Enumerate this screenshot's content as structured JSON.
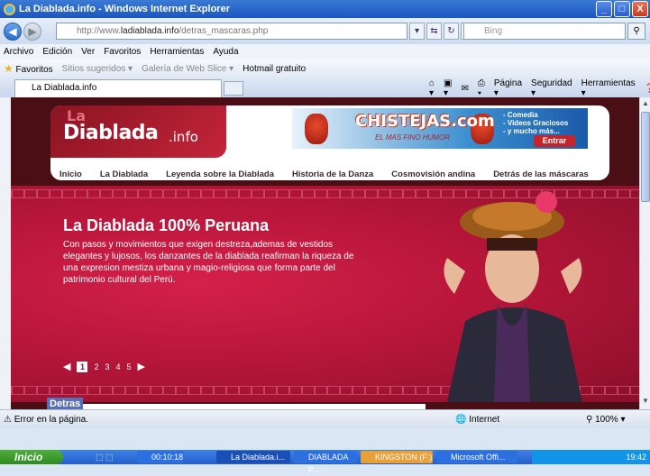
{
  "window": {
    "title": "La Diablada.info - Windows Internet Explorer",
    "minimize": "_",
    "maximize": "□",
    "close": "X"
  },
  "address": {
    "url_prefix": "http://www.",
    "url_domain": "ladiablada.info",
    "url_path": "/detras_mascaras.php",
    "search_placeholder": "Bing"
  },
  "menu": [
    "Archivo",
    "Edición",
    "Ver",
    "Favoritos",
    "Herramientas",
    "Ayuda"
  ],
  "favbar": {
    "favorites": "Favoritos",
    "suggested": "Sitios sugeridos ▾",
    "gallery": "Galería de Web Slice ▾",
    "hotmail": "Hotmail gratuito"
  },
  "tab": {
    "label": "La Diablada.info"
  },
  "tabtools": {
    "page": "Página ▾",
    "security": "Seguridad ▾",
    "tools": "Herramientas ▾"
  },
  "site": {
    "logo_la": "La",
    "logo_main": "Diablada",
    "logo_info": ".info",
    "banner": {
      "title": "CHISTEJAS.com",
      "subtitle": "EL MAS FINO HUMOR",
      "items": [
        "- Comedia",
        "- Videos Graciosos",
        "- y mucho más..."
      ],
      "button": "Entrar"
    },
    "nav": [
      "Inicio",
      "La Diablada",
      "Leyenda sobre la Diablada",
      "Historia de la Danza",
      "Cosmovisión andina",
      "Detrás de las máscaras"
    ],
    "hero": {
      "title": "La Diablada 100% Peruana",
      "text": "Con pasos y movimientos que exigen destreza,ademas de vestidos elegantes y lujosos, los danzantes de la diablada reafirman la riqueza de una expresion mestiza urbana y magio-religiosa que forma parte del patrimonio cultural del Perú."
    },
    "pager": {
      "current": "1",
      "pages": [
        "2",
        "3",
        "4",
        "5"
      ]
    },
    "bottom_tag": "Detras"
  },
  "status": {
    "error": "Error en la página.",
    "zone": "Internet",
    "zoom": "100%"
  },
  "taskbar": {
    "start": "Inicio",
    "timer": "00:10:18",
    "items": [
      "La Diablada.i...",
      "DIABLADA P...",
      "KINGSTON (F:)",
      "Microsoft Offi..."
    ],
    "clock": "19:42"
  },
  "colors": {
    "brand": "#c4243a",
    "hero": "#b8163a"
  }
}
